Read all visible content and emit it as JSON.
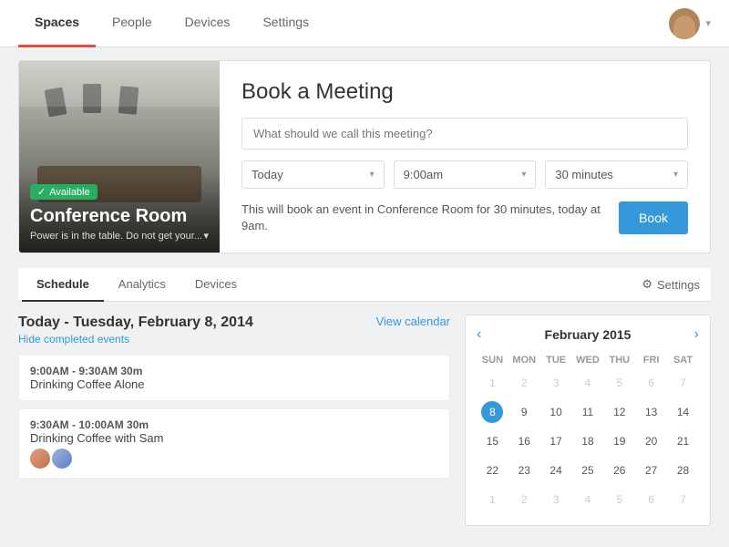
{
  "nav": {
    "items": [
      {
        "label": "Spaces",
        "active": true
      },
      {
        "label": "People",
        "active": false
      },
      {
        "label": "Devices",
        "active": false
      },
      {
        "label": "Settings",
        "active": false
      }
    ]
  },
  "card": {
    "badge": "Available",
    "room_name": "Conference Room",
    "room_desc": "Power is in the table. Do not get your...",
    "book_title": "Book a Meeting",
    "meeting_placeholder": "What should we call this meeting?",
    "day_select": "Today",
    "time_select": "9:00am",
    "duration_select": "30 minutes",
    "info_text": "This will book an event in Conference Room for 30 minutes, today at 9am.",
    "book_label": "Book"
  },
  "tabs": {
    "items": [
      {
        "label": "Schedule",
        "active": true
      },
      {
        "label": "Analytics",
        "active": false
      },
      {
        "label": "Devices",
        "active": false
      }
    ],
    "settings_label": "Settings"
  },
  "schedule": {
    "date_label": "Today - Tuesday, February 8, 2014",
    "view_calendar": "View calendar",
    "hide_label": "Hide completed events",
    "events": [
      {
        "time": "9:00AM - 9:30AM  30m",
        "name": "Drinking Coffee Alone",
        "has_avatars": false
      },
      {
        "time": "9:30AM - 10:00AM  30m",
        "name": "Drinking Coffee with Sam",
        "has_avatars": true
      }
    ]
  },
  "calendar": {
    "title": "February  2015",
    "days_header": [
      "SUN",
      "MON",
      "TUE",
      "WED",
      "THU",
      "FRI",
      "SAT"
    ],
    "weeks": [
      [
        {
          "d": "1",
          "om": true
        },
        {
          "d": "2",
          "om": true
        },
        {
          "d": "3",
          "om": true
        },
        {
          "d": "4",
          "om": true
        },
        {
          "d": "5",
          "om": true
        },
        {
          "d": "6",
          "om": true
        },
        {
          "d": "7",
          "om": true
        }
      ],
      [
        {
          "d": "8",
          "today": true
        },
        {
          "d": "9"
        },
        {
          "d": "10"
        },
        {
          "d": "11"
        },
        {
          "d": "12"
        },
        {
          "d": "13"
        },
        {
          "d": "14"
        }
      ],
      [
        {
          "d": "15"
        },
        {
          "d": "16"
        },
        {
          "d": "17"
        },
        {
          "d": "18"
        },
        {
          "d": "19"
        },
        {
          "d": "20"
        },
        {
          "d": "21"
        }
      ],
      [
        {
          "d": "22"
        },
        {
          "d": "23"
        },
        {
          "d": "24"
        },
        {
          "d": "25"
        },
        {
          "d": "26"
        },
        {
          "d": "27"
        },
        {
          "d": "28"
        }
      ],
      [
        {
          "d": "1",
          "om": true
        },
        {
          "d": "2",
          "om": true
        },
        {
          "d": "3",
          "om": true
        },
        {
          "d": "4",
          "om": true
        },
        {
          "d": "5",
          "om": true
        },
        {
          "d": "6",
          "om": true
        },
        {
          "d": "7",
          "om": true
        }
      ]
    ]
  }
}
